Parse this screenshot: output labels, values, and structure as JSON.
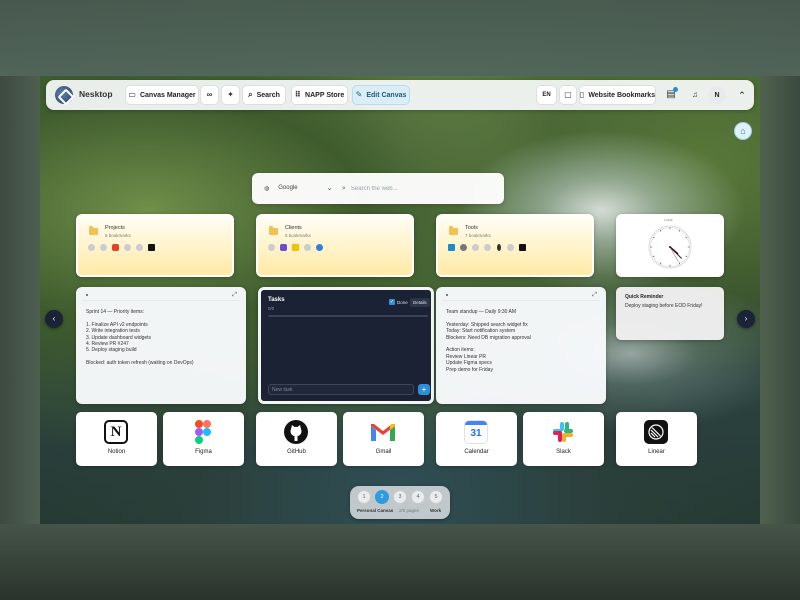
{
  "topbar": {
    "brand": "Nesktop",
    "canvas_manager": "Canvas Manager",
    "search": "Search",
    "store": "NAPP Store",
    "edit_canvas": "Edit Canvas",
    "language": "EN",
    "bookmarks": "Website Bookmarks",
    "avatar": "N"
  },
  "search_bar": {
    "engine": "Google",
    "placeholder": "Search the web..."
  },
  "folders": [
    {
      "title": "Projects",
      "count": "6 bookmarks"
    },
    {
      "title": "Clients",
      "count": "5 bookmarks"
    },
    {
      "title": "Tools",
      "count": "7 bookmarks"
    }
  ],
  "clock": {
    "label": "Local",
    "hours": 4,
    "minutes": 22,
    "seconds": 25
  },
  "notes": {
    "sprint": "Sprint 14 — Priority items:\n\n1. Finalize API v2 endpoints\n2. Write integration tests\n3. Update dashboard widgets\n4. Review PR #247\n5. Deploy staging build\n\nBlocked: auth token refresh (waiting on DevOps)",
    "standup": "Team standup — Daily 9:30 AM\n\nYesterday: Shipped search widget fix\nToday: Start notification system\nBlockers: Need DB migration approval\n\nAction items:\nReview Linear PR\nUpdate Figma specs\nPrep demo for Friday"
  },
  "tasks": {
    "title": "Tasks",
    "count": "0/0",
    "done_label": "Done",
    "details_label": "Details",
    "new_placeholder": "New task",
    "add_label": "+"
  },
  "reminder": {
    "title": "Quick Reminder",
    "text": "Deploy staging before EOD Friday!"
  },
  "apps": [
    "Notion",
    "Figma",
    "GitHub",
    "Gmail",
    "Calendar",
    "Slack",
    "Linear"
  ],
  "calendar_day": "31",
  "pager": {
    "pages": [
      "1",
      "2",
      "3",
      "4",
      "5"
    ],
    "active_index": 1,
    "left_label": "Personal Canvas",
    "middle_label": "2/5 pages",
    "right_label": "Work"
  },
  "colors": {
    "accent": "#2f9be0",
    "tasks_bg": "#1b2233",
    "folder_gradient_end": "#ffe9a6"
  }
}
